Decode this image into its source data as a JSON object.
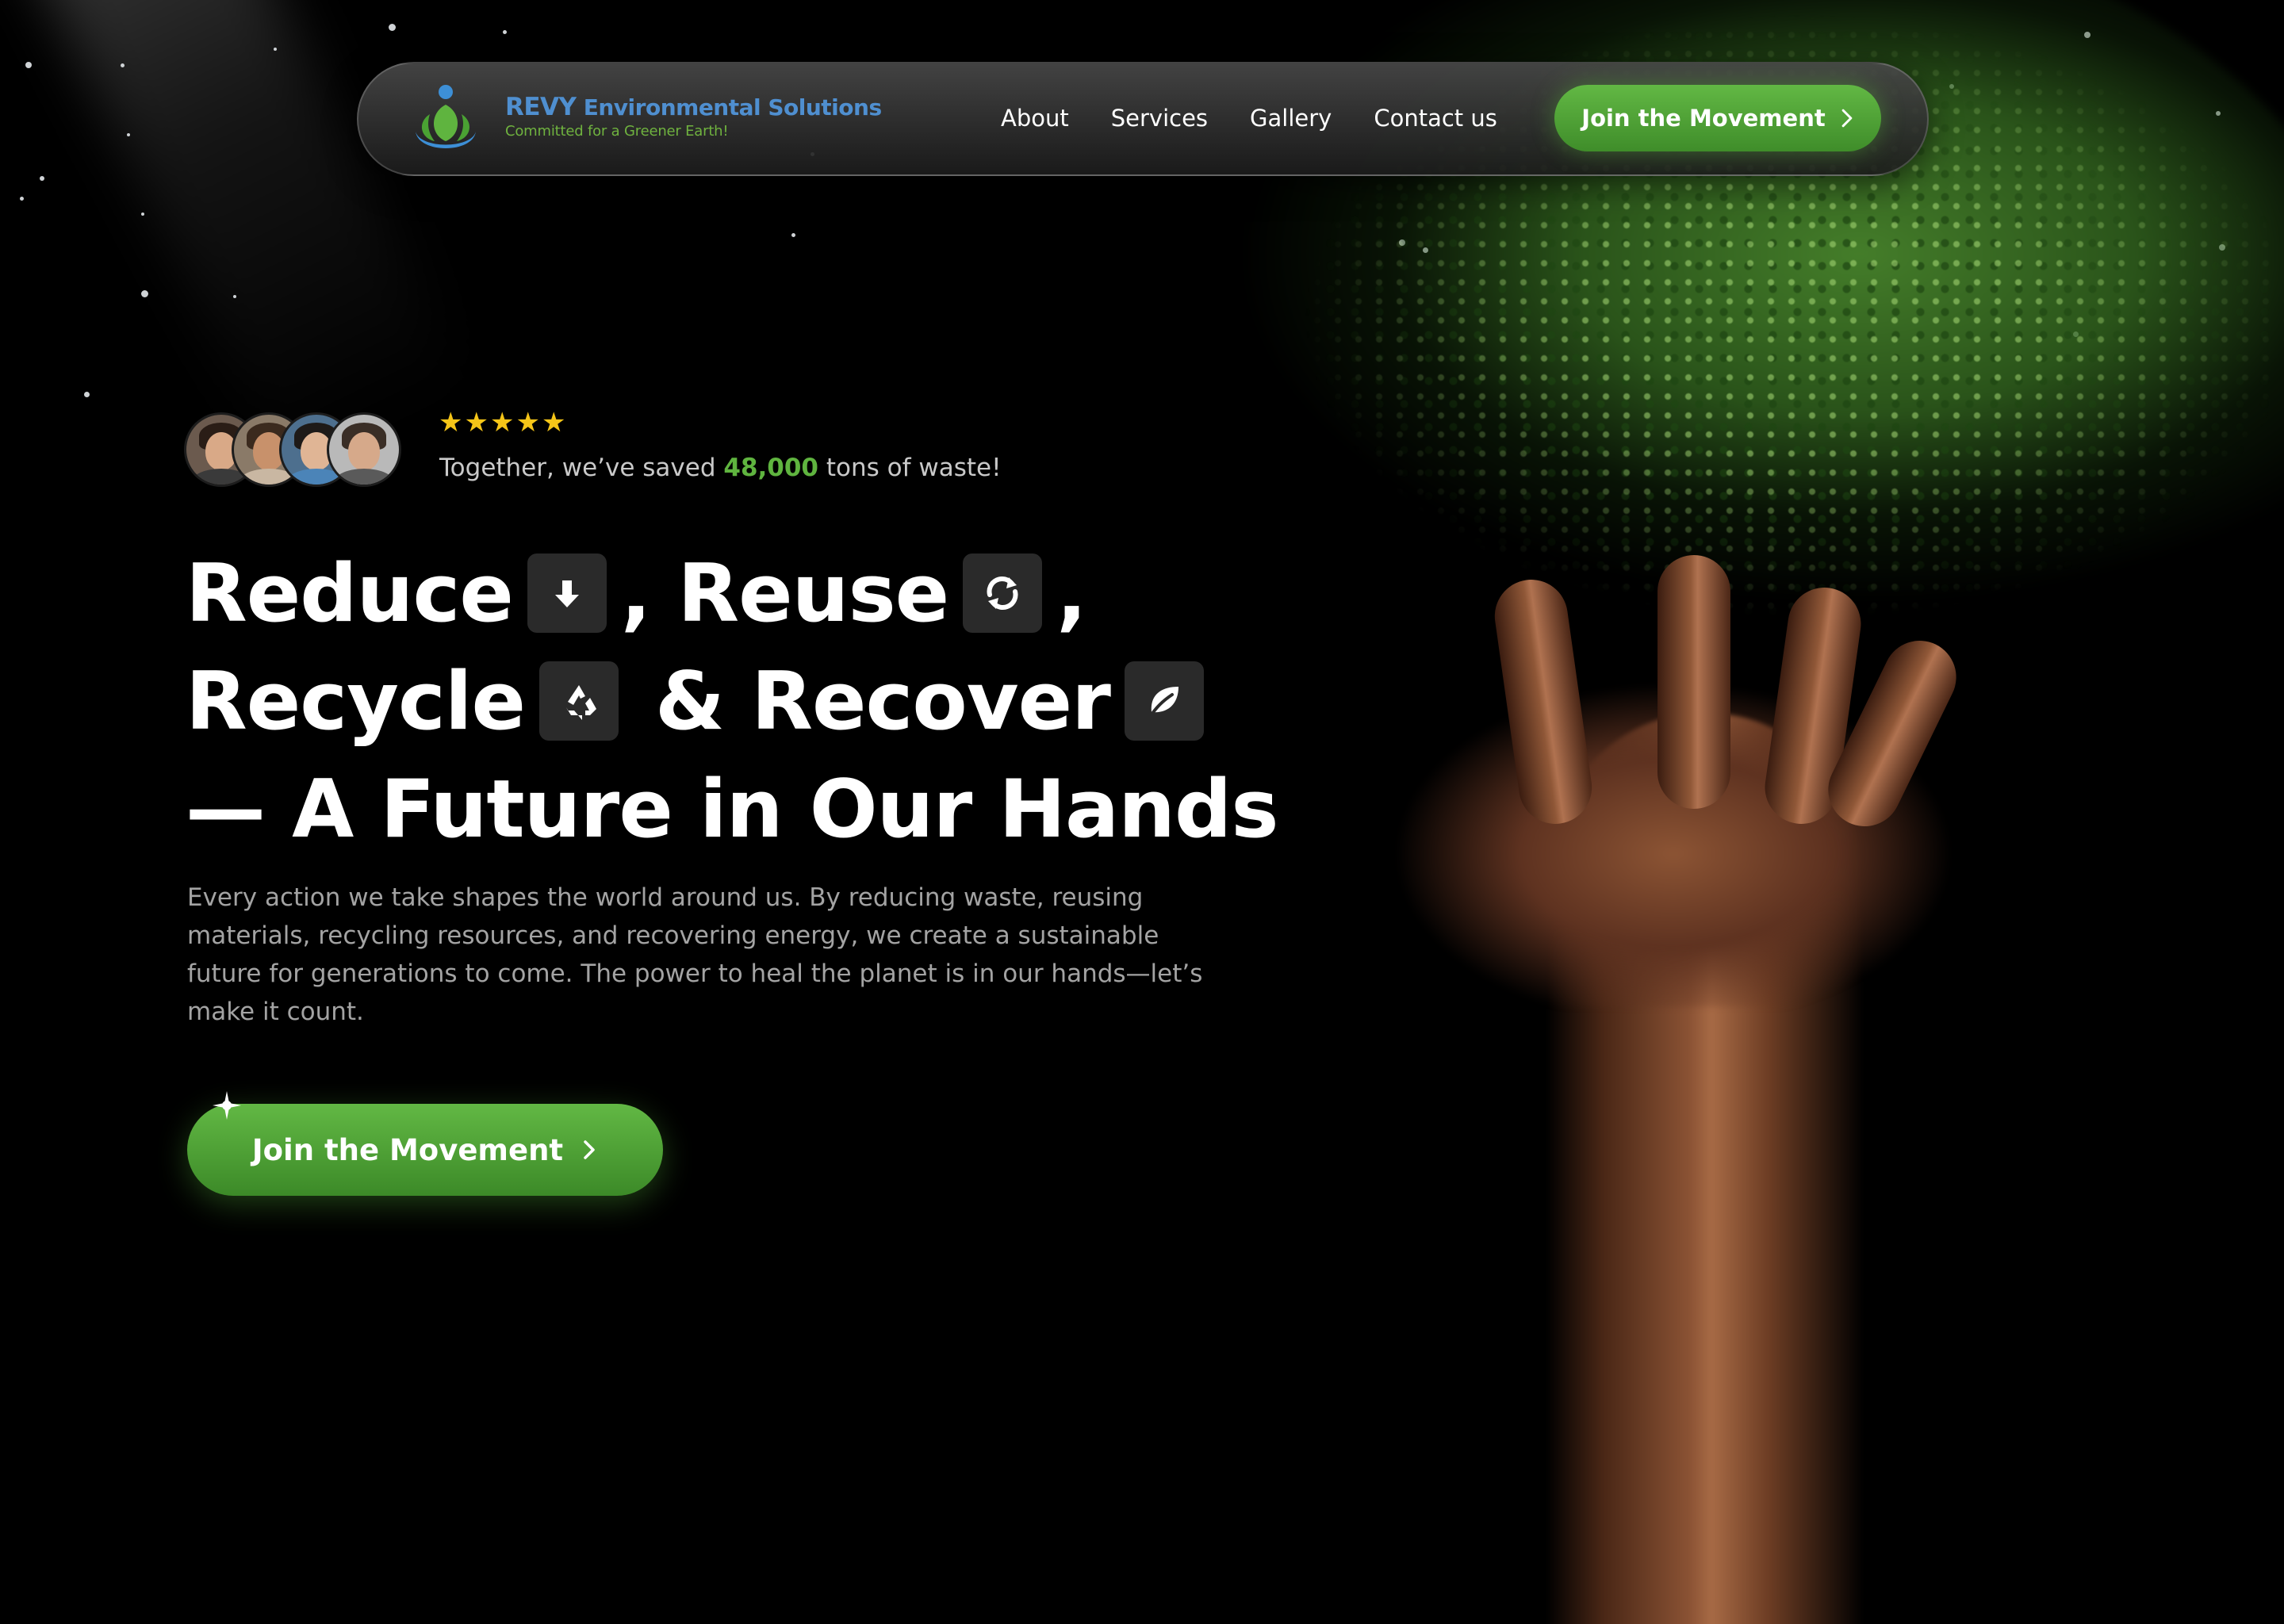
{
  "brand": {
    "name_prefix": "REVY",
    "name_rest": " Environmental Solutions",
    "tagline": "Committed for a Greener Earth!"
  },
  "nav": {
    "links": [
      "About",
      "Services",
      "Gallery",
      "Contact us"
    ],
    "cta_label": "Join the Movement"
  },
  "proof": {
    "rating_stars": 5,
    "text_before": "Together, we’ve saved ",
    "number": "48,000",
    "text_after": " tons of waste!"
  },
  "headline": {
    "reduce": "Reduce",
    "reuse": ", Reuse",
    "comma": ",",
    "recycle": "Recycle",
    "recover": "& Recover",
    "line3": "— A Future in Our Hands"
  },
  "description": "Every action we take shapes the world around us. By reducing waste, reusing materials, recycling resources, and recovering energy, we create a sustainable future for generations to come. The power to heal the planet is in our hands—let’s make it count.",
  "hero": {
    "cta_label": "Join the Movement"
  },
  "icons": {
    "reduce": "arrow-down-icon",
    "reuse": "refresh-icon",
    "recycle": "recycle-icon",
    "recover": "leaf-icon",
    "chevron": "chevron-right-icon"
  },
  "colors": {
    "accent_green": "#5fb43f",
    "brand_blue": "#4f8fd0",
    "star_yellow": "#f5c518",
    "background": "#000000"
  }
}
